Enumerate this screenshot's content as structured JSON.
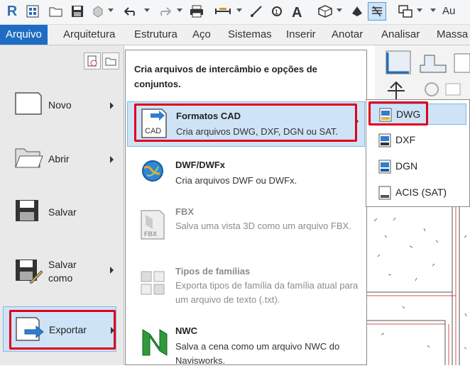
{
  "quick_access": {
    "right_text": "Au"
  },
  "ribbon_tabs": [
    {
      "label": "Arquivo",
      "active": true
    },
    {
      "label": "Arquitetura"
    },
    {
      "label": "Estrutura"
    },
    {
      "label": "Aço"
    },
    {
      "label": "Sistemas"
    },
    {
      "label": "Inserir"
    },
    {
      "label": "Anotar"
    },
    {
      "label": "Analisar"
    },
    {
      "label": "Massa e"
    }
  ],
  "app_menu": {
    "items": [
      {
        "label": "Novo",
        "has_submenu": true
      },
      {
        "label": "Abrir",
        "has_submenu": true
      },
      {
        "label": "Salvar",
        "has_submenu": false
      },
      {
        "label": "Salvar como",
        "has_submenu": true
      },
      {
        "label": "Exportar",
        "has_submenu": true,
        "selected": true
      }
    ]
  },
  "export_menu": {
    "header": "Cria arquivos de intercâmbio e opções de conjuntos.",
    "items": [
      {
        "title": "Formatos CAD",
        "description": "Cria arquivos DWG, DXF, DGN ou SAT.",
        "has_submenu": true,
        "selected": true,
        "icon": "cad-icon",
        "icon_text": "CAD"
      },
      {
        "title": "DWF/DWFx",
        "description": "Cria arquivos DWF ou DWFx.",
        "icon": "globe-icon"
      },
      {
        "title": "FBX",
        "description": "Salva uma vista 3D como um arquivo FBX.",
        "disabled": true,
        "icon": "fbx-icon",
        "icon_text": "FBX"
      },
      {
        "title": "Tipos de famílias",
        "description": "Exporta tipos de família da família atual para um arquivo de texto (.txt).",
        "disabled": true,
        "icon": "family-types-icon"
      },
      {
        "title": "NWC",
        "description": "Salva a cena como um arquivo NWC do Navisworks.",
        "icon": "navisworks-icon"
      }
    ]
  },
  "cad_formats_menu": {
    "items": [
      {
        "label": "DWG",
        "selected": true
      },
      {
        "label": "DXF"
      },
      {
        "label": "DGN"
      },
      {
        "label": "ACIS (SAT)"
      }
    ]
  },
  "colors": {
    "accent": "#1f6dc2",
    "highlight_bg": "#cfe3f6",
    "highlight_border": "#86b6e3",
    "annotation_red": "#e0001b"
  }
}
